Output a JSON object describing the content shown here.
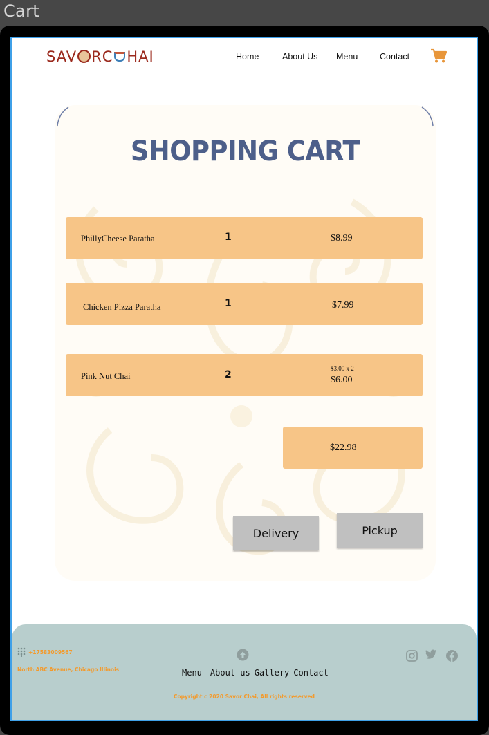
{
  "window": {
    "title": "Cart"
  },
  "header": {
    "logo": {
      "part1": "SAV",
      "part2": "R ",
      "part3": "C",
      "part4": "HAI"
    },
    "nav": [
      "Home",
      "About Us",
      "Menu",
      "Contact"
    ],
    "cart_icon": "shopping-cart-icon"
  },
  "cart": {
    "title": "SHOPPING CART",
    "items": [
      {
        "name": "PhillyCheese Paratha",
        "qty": "1",
        "price": "$8.99"
      },
      {
        "name": "Chicken Pizza Paratha",
        "qty": "1",
        "price": "$7.99"
      },
      {
        "name": "Pink Nut Chai",
        "qty": "2",
        "unit": "$3.00 x 2",
        "price": "$6.00"
      }
    ],
    "total": "$22.98",
    "buttons": {
      "delivery": "Delivery",
      "pickup": "Pickup"
    }
  },
  "footer": {
    "phone": "+17583009567",
    "address": "North ABC Avenue, Chicago Illinois",
    "links": [
      "Menu",
      "About us",
      "Gallery",
      "Contact"
    ],
    "copyright": "Copyright c 2020 Savor Chai, All rights reserved",
    "social_icons": [
      "instagram-icon",
      "twitter-icon",
      "facebook-icon"
    ]
  },
  "colors": {
    "brand": "#9b2a1e",
    "title": "#4d5f8a",
    "row_fill": "#f7c587",
    "footer_bg": "#b8cecd",
    "accent": "#f39a2c",
    "cart_icon": "#e8963a"
  }
}
